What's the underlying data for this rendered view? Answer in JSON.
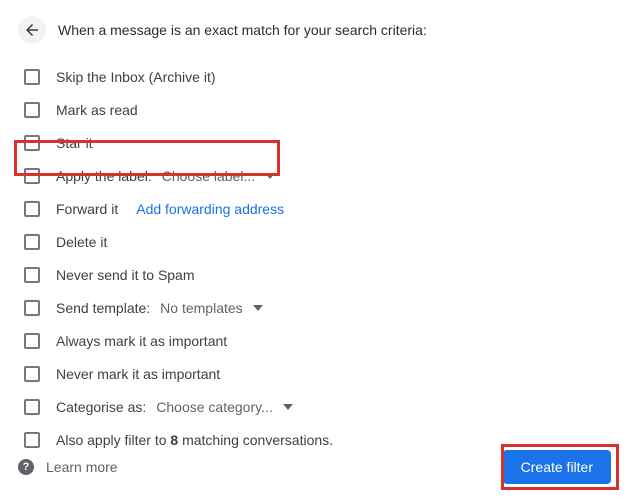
{
  "header": {
    "text": "When a message is an exact match for your search criteria:"
  },
  "options": {
    "skip_inbox": "Skip the Inbox (Archive it)",
    "mark_read": "Mark as read",
    "star": "Star it",
    "apply_label": "Apply the label:",
    "apply_label_dd": "Choose label...",
    "forward": "Forward it",
    "forward_link": "Add forwarding address",
    "delete": "Delete it",
    "never_spam": "Never send it to Spam",
    "template": "Send template:",
    "template_dd": "No templates",
    "mark_important": "Always mark it as important",
    "never_important": "Never mark it as important",
    "categorise": "Categorise as:",
    "categorise_dd": "Choose category...",
    "also_apply_pre": "Also apply filter to ",
    "also_apply_count": "8",
    "also_apply_post": " matching conversations."
  },
  "footer": {
    "learn_more": "Learn more",
    "create": "Create filter"
  }
}
